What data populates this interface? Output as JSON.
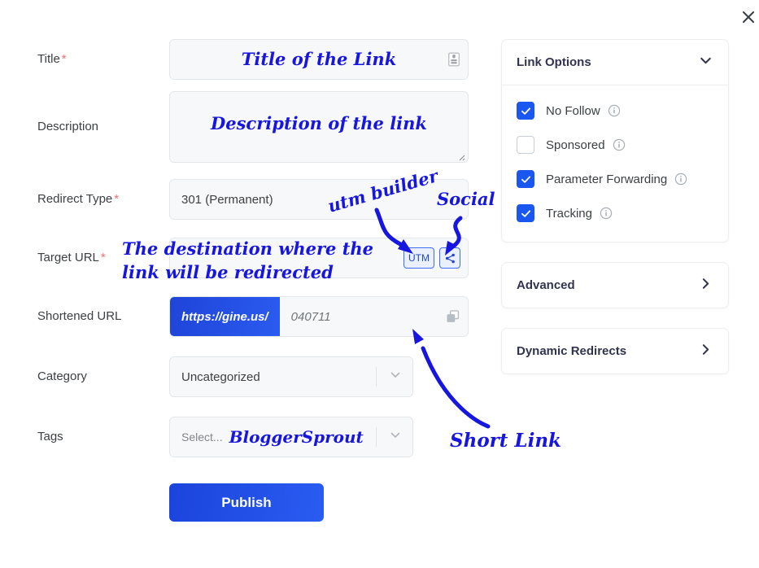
{
  "window": {
    "close_icon": "close-icon"
  },
  "form": {
    "fields": [
      {
        "label": "Title",
        "required": true,
        "value": "Title of the Link",
        "handwritten": true,
        "trailing_icon": "document-icon"
      },
      {
        "label": "Description",
        "required": false,
        "value": "Description of the link",
        "handwritten": true
      },
      {
        "label": "Redirect Type",
        "required": true,
        "value": "301 (Permanent)"
      },
      {
        "label": "Target URL",
        "required": true,
        "value": ""
      },
      {
        "label": "Shortened URL",
        "required": false,
        "prefix": "https://gine.us/",
        "value": "040711",
        "trailing_icon": "copy-icon"
      },
      {
        "label": "Category",
        "required": false,
        "value": "Uncategorized"
      },
      {
        "label": "Tags",
        "required": false,
        "placeholder": "Select...",
        "value": "BloggerSprout",
        "handwritten": true
      }
    ],
    "utm_button": "UTM",
    "social_button_icon": "share-icon",
    "publish_label": "Publish"
  },
  "side": {
    "link_options": {
      "title": "Link Options",
      "expanded": true,
      "chevron_icon": "chevron-down-icon",
      "checkboxes": [
        {
          "label": "No Follow",
          "checked": true,
          "info_icon": "info-icon"
        },
        {
          "label": "Sponsored",
          "checked": false,
          "info_icon": "info-icon"
        },
        {
          "label": "Parameter Forwarding",
          "checked": true,
          "info_icon": "info-icon"
        },
        {
          "label": "Tracking",
          "checked": true,
          "info_icon": "info-icon"
        }
      ]
    },
    "advanced": {
      "title": "Advanced",
      "chevron_icon": "chevron-right-icon"
    },
    "dynamic_redirects": {
      "title": "Dynamic Redirects",
      "chevron_icon": "chevron-right-icon"
    }
  },
  "annotations": [
    {
      "id": "utm_builder",
      "text": "utm builder"
    },
    {
      "id": "social",
      "text": "Social"
    },
    {
      "id": "target_url_note_line1",
      "text": "The destination where the"
    },
    {
      "id": "target_url_note_line2",
      "text": "link will be redirected"
    },
    {
      "id": "short_link",
      "text": "Short Link"
    }
  ],
  "colors": {
    "accent_blue": "#1a56f0",
    "publish_blue": "#1b44dc",
    "annotation_blue": "#1616e0",
    "required_red": "#f86d6d",
    "panel_title": "#32334f",
    "field_bg": "#f7f8f9"
  }
}
